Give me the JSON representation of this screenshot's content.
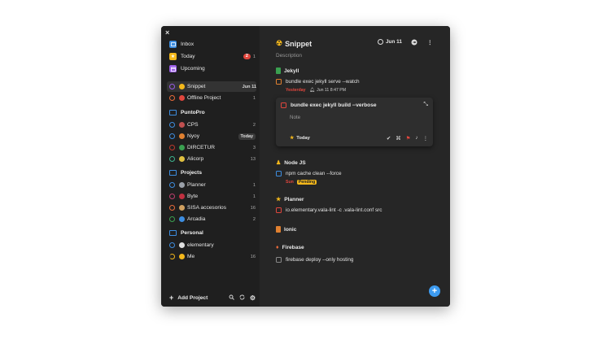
{
  "window": {
    "close_glyph": "×"
  },
  "sidebar": {
    "inbox": {
      "label": "Inbox",
      "color": "#3d8de0"
    },
    "today": {
      "label": "Today",
      "badge": "2",
      "count": "1",
      "color": "#f4b81b"
    },
    "upcoming": {
      "label": "Upcoming",
      "color": "#9a5ce5"
    },
    "projects_top": [
      {
        "label": "Snippet",
        "emoji": "☢",
        "date": "Jun 11",
        "ring": "#9a5ce5"
      },
      {
        "label": "Offline Project",
        "emoji": "●",
        "count": "1",
        "ring": "#e96a3a"
      }
    ],
    "areas": [
      {
        "name": "PuntoPro",
        "items": [
          {
            "label": "CPS",
            "count": "2",
            "ring": "#3d8de0",
            "emoji_color": "#c05050"
          },
          {
            "label": "Nyoy",
            "pill": "Today",
            "ring": "#3d8de0",
            "emoji_color": "#e08030"
          },
          {
            "label": "DIRCETUR",
            "count": "3",
            "ring": "#c0392b",
            "emoji_color": "#3aa050"
          },
          {
            "label": "Alicorp",
            "count": "13",
            "ring": "#3db38d",
            "emoji_color": "#e0c040"
          }
        ]
      },
      {
        "name": "Projects",
        "items": [
          {
            "label": "Planner",
            "count": "1",
            "ring": "#3d8de0",
            "emoji_color": "#9aa0a8"
          },
          {
            "label": "Byte",
            "count": "1",
            "ring": "#c04070",
            "emoji_color": "#c03040"
          },
          {
            "label": "SISA accesorios",
            "count": "16",
            "ring": "#e96a3a",
            "emoji_color": "#d0a060"
          },
          {
            "label": "Arcadia",
            "count": "2",
            "ring": "#3aa050",
            "emoji_color": "#3d8de0"
          }
        ]
      },
      {
        "name": "Personal",
        "items": [
          {
            "label": "elementary",
            "count": "",
            "ring": "#3d8de0",
            "emoji_color": "#e0e0e0"
          },
          {
            "label": "Me",
            "count": "16",
            "ring": "#f4b81b",
            "emoji_color": "#f4b81b"
          }
        ]
      }
    ],
    "footer": {
      "add_label": "Add Project"
    }
  },
  "main": {
    "title": "Snippet",
    "title_emoji": "☢",
    "description": "Description",
    "date_button": "Jun 11",
    "sections": {
      "jekyll": "Jekyll",
      "node": "Node JS",
      "planner": "Planner",
      "ionic": "Ionic",
      "firebase": "Firebase"
    },
    "tasks": {
      "t1": {
        "text": "bundle exec jekyll serve --watch",
        "when": "Yesterday",
        "reminder": "Jun 11 8:47 PM"
      },
      "card": {
        "text": "bundle exec jekyll build --verbose",
        "note": "Note",
        "when": "Today"
      },
      "t2": {
        "text": "npm cache clean --force",
        "when": "Sun",
        "tag": "Pending"
      },
      "t3": {
        "text": "io.elementary.vala-lint -c .vala-lint.conf src"
      },
      "t4": {
        "text": "firebase deploy --only hosting"
      }
    },
    "fab": "+"
  },
  "colors": {
    "accent": "#3d9bf0",
    "overdue": "#e0463d",
    "warning": "#f4b81b"
  }
}
